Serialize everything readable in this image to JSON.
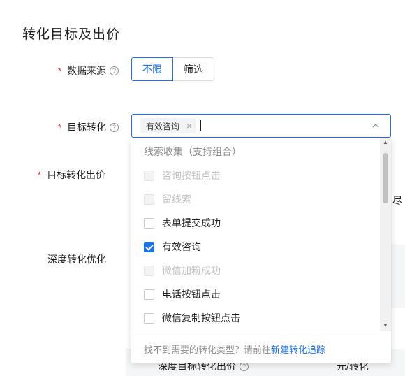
{
  "section_title": "转化目标及出价",
  "help_glyph": "?",
  "required_mark": "*",
  "fields": {
    "data_source": {
      "label": "数据来源",
      "options": [
        "不限",
        "筛选"
      ],
      "selected": "不限"
    },
    "target_conversion": {
      "label": "目标转化",
      "selected_tags": [
        "有效咨询"
      ],
      "tag_close": "×"
    },
    "target_bid": {
      "label": "目标转化出价"
    },
    "deep_optimization": {
      "label": "深度转化优化"
    },
    "deep_bid": {
      "label": "深度目标转化出价",
      "unit": "元/转化"
    },
    "partial_right_text": "尽"
  },
  "dropdown": {
    "group_title": "线索收集（支持组合）",
    "options": [
      {
        "label": "咨询按钮点击",
        "checked": false,
        "disabled": true
      },
      {
        "label": "留线索",
        "checked": false,
        "disabled": true
      },
      {
        "label": "表单提交成功",
        "checked": false,
        "disabled": false
      },
      {
        "label": "有效咨询",
        "checked": true,
        "disabled": false
      },
      {
        "label": "微信加粉成功",
        "checked": false,
        "disabled": true
      },
      {
        "label": "电话按钮点击",
        "checked": false,
        "disabled": false
      },
      {
        "label": "微信复制按钮点击",
        "checked": false,
        "disabled": false
      }
    ],
    "footer_text": "找不到需要的转化类型？请前往",
    "footer_link": "新建转化追踪",
    "scroll_up": "▲",
    "scroll_down": "▼"
  },
  "colors": {
    "accent": "#1a73e8",
    "required": "#f5222d"
  }
}
